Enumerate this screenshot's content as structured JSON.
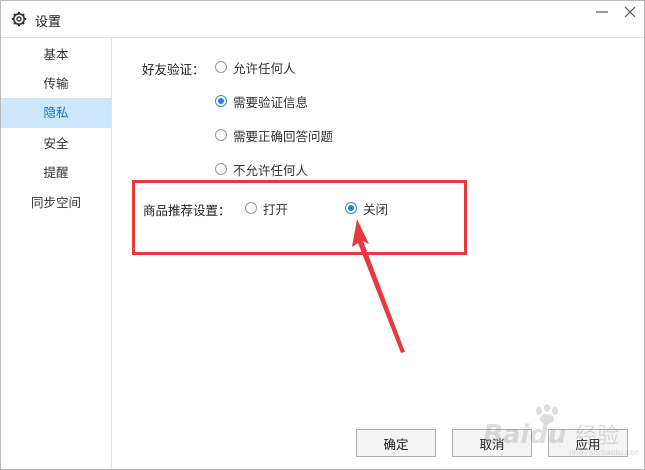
{
  "window": {
    "title": "设置"
  },
  "sidebar": {
    "items": [
      {
        "label": "基本",
        "active": false
      },
      {
        "label": "传输",
        "active": false
      },
      {
        "label": "隐私",
        "active": true
      },
      {
        "label": "安全",
        "active": false
      },
      {
        "label": "提醒",
        "active": false
      },
      {
        "label": "同步空间",
        "active": false
      }
    ]
  },
  "friend_verification": {
    "label": "好友验证：",
    "options": [
      {
        "label": "允许任何人",
        "checked": false
      },
      {
        "label": "需要验证信息",
        "checked": true
      },
      {
        "label": "需要正确回答问题",
        "checked": false
      },
      {
        "label": "不允许任何人",
        "checked": false
      }
    ]
  },
  "product_recommendation": {
    "label": "商品推荐设置：",
    "options": [
      {
        "label": "打开",
        "checked": false
      },
      {
        "label": "关闭",
        "checked": true
      }
    ]
  },
  "buttons": {
    "ok": "确定",
    "cancel": "取消",
    "apply": "应用"
  },
  "watermark": {
    "brand": "Baidu",
    "sub": "经验",
    "domain": "jingyan.baidu.com"
  },
  "colors": {
    "accent": "#2a7fd4",
    "active_bg": "#cde6f9",
    "highlight": "#e63a3f"
  }
}
